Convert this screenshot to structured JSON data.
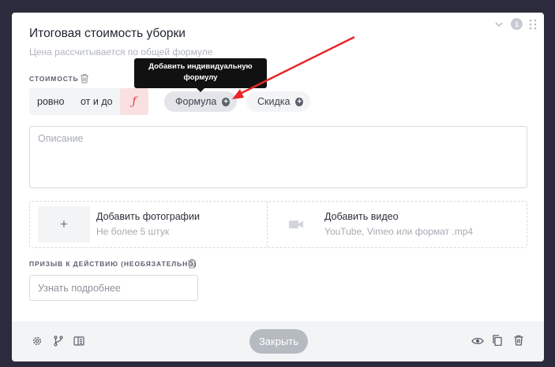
{
  "block": {
    "title": "Итоговая стоимость уборки",
    "subtitle": "Цена рассчитывается по общей формуле",
    "badge_count": "1"
  },
  "cost": {
    "label": "СТОИМОСТЬ",
    "modes": [
      "ровно",
      "от и до",
      "ƒ"
    ],
    "active_mode": "ƒ",
    "pills": [
      {
        "label": "Формула",
        "icon": "plus-circle-icon"
      },
      {
        "label": "Скидка",
        "icon": "plus-circle-icon"
      }
    ],
    "tooltip": "Добавить индивидуальную формулу"
  },
  "description": {
    "placeholder": "Описание"
  },
  "media": {
    "photo": {
      "title": "Добавить фотографии",
      "subtitle": "Не более 5 штук",
      "button": "+"
    },
    "video": {
      "title": "Добавить видео",
      "subtitle": "YouTube, Vimeo или формат .mp4"
    }
  },
  "cta": {
    "label": "ПРИЗЫВ К ДЕЙСТВИЮ (НЕОБЯЗАТЕЛЬНО)",
    "placeholder": "Узнать подробнее"
  },
  "footer": {
    "close_label": "Закрыть",
    "left_icons": [
      "gear-icon",
      "branch-icon",
      "layout-icon"
    ],
    "right_icons": [
      "eye-icon",
      "copy-icon",
      "trash-icon"
    ]
  },
  "colors": {
    "background": "#2b2b3d",
    "accent": "#e0393e",
    "annotation_arrow": "#e8262a"
  }
}
